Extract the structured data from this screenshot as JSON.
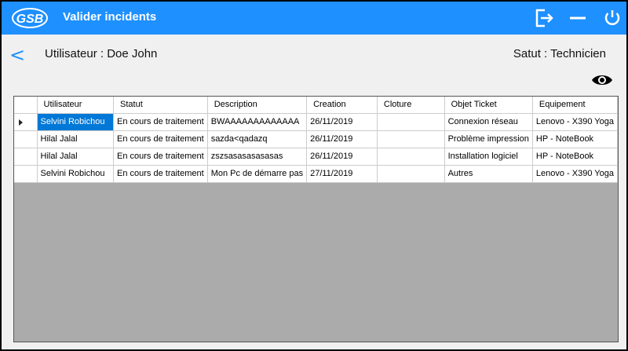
{
  "app": {
    "logo_text": "GSB",
    "title": "Valider incidents"
  },
  "header": {
    "back_label": "<",
    "user": "Utilisateur : Doe John",
    "role": "Satut : Technicien"
  },
  "table": {
    "columns": [
      "Utilisateur",
      "Statut",
      "Description",
      "Creation",
      "Cloture",
      "Objet Ticket",
      "Equipement"
    ],
    "rows": [
      [
        "Selvini Robichou",
        "En cours de traitement",
        "BWAAAAAAAAAAAAA",
        "26/11/2019",
        "",
        "Connexion réseau",
        "Lenovo - X390 Yoga"
      ],
      [
        "Hilal Jalal",
        "En cours de traitement",
        "sazda<qadazq",
        "26/11/2019",
        "",
        "Problème impression",
        "HP - NoteBook"
      ],
      [
        "Hilal Jalal",
        "En cours de traitement",
        "zszsasasasasasas",
        "26/11/2019",
        "",
        "Installation logiciel",
        "HP - NoteBook"
      ],
      [
        "Selvini Robichou",
        "En cours de traitement",
        "Mon Pc de démarre pas",
        "27/11/2019",
        "",
        "Autres",
        "Lenovo - X390 Yoga"
      ]
    ],
    "selected_row": 0
  },
  "colors": {
    "accent": "#1e90ff",
    "selection": "#0078d7",
    "grid_bg": "#ababab"
  },
  "icons": [
    "logout-icon",
    "minimize-icon",
    "power-icon",
    "back-arrow-icon",
    "eye-icon",
    "row-pointer-icon"
  ]
}
